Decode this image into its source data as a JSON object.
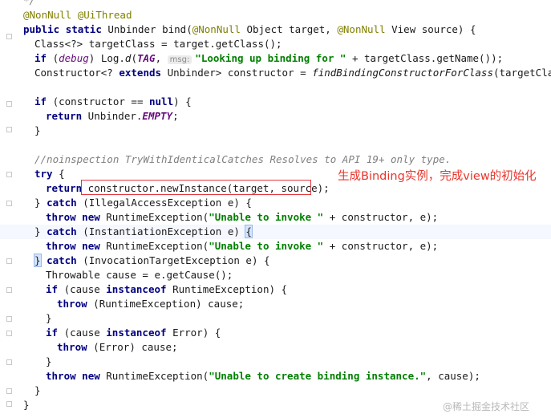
{
  "code": {
    "top_fragment": "*/",
    "annotation_line": {
      "a1": "@NonNull",
      "a2": "@UiThread"
    },
    "signature": {
      "k1": "public",
      "k2": "static",
      "t1": "Unbinder bind(",
      "a1": "@NonNull",
      "t2": " Object target, ",
      "a2": "@NonNull",
      "t3": " View source) {"
    },
    "line_target_class": "Class<?> targetClass = target.getClass();",
    "line_debug": {
      "k1": "if",
      "t1": " (",
      "debug": "debug",
      "t2": ") Log.",
      "d": "d",
      "t3": "(",
      "tag": "TAG",
      "t4": ",",
      "msg_hint": "msg:",
      "s1": "\"Looking up binding for \"",
      "t5": " + targetClass.getName());"
    },
    "line_constructor": {
      "t1": "Constructor<? ",
      "k1": "extends",
      "t2": " Unbinder> constructor = ",
      "m1": "findBindingConstructorForClass",
      "t3": "(targetClass);"
    },
    "line_if_null": {
      "k1": "if",
      "t1": " (constructor == ",
      "k2": "null",
      "t2": ") {"
    },
    "line_return_empty": {
      "k1": "return",
      "t1": " Unbinder.",
      "f1": "EMPTY",
      "t2": ";"
    },
    "close_brace": "}",
    "comment_noinspection": "//noinspection TryWithIdenticalCatches Resolves to API 19+ only type.",
    "line_try": {
      "k1": "try",
      "t1": " {"
    },
    "line_return_new_instance": {
      "k1": "return",
      "t1": " constructor.newInstance(target, source);"
    },
    "line_catch_illegal": {
      "t0": "} ",
      "k1": "catch",
      "t1": " (IllegalAccessException e) {"
    },
    "line_throw1": {
      "k1": "throw",
      "k2": "new",
      "t1": " RuntimeException(",
      "s1": "\"Unable to invoke \"",
      "t2": " + constructor, e);"
    },
    "line_catch_instantiation": {
      "t0": "} ",
      "k1": "catch",
      "t1": " (InstantiationException e) ",
      "b1": "{"
    },
    "line_throw2": {
      "k1": "throw",
      "k2": "new",
      "t1": " RuntimeException(",
      "s1": "\"Unable to invoke \"",
      "t2": " + constructor, e);"
    },
    "line_catch_ite": {
      "b0": "}",
      "k1": "catch",
      "t1": " (InvocationTargetException e) {"
    },
    "line_throwable": "Throwable cause = e.getCause();",
    "line_if_runtime": {
      "k1": "if",
      "t1": " (cause ",
      "k2": "instanceof",
      "t2": " RuntimeException) {"
    },
    "line_throw_runtime": {
      "k1": "throw",
      "t1": " (RuntimeException) cause;"
    },
    "line_if_error": {
      "k1": "if",
      "t1": " (cause ",
      "k2": "instanceof",
      "t2": " Error) {"
    },
    "line_throw_error": {
      "k1": "throw",
      "t1": " (Error) cause;"
    },
    "line_throw_final": {
      "k1": "throw",
      "k2": "new",
      "t1": " RuntimeException(",
      "s1": "\"Unable to create binding instance.\"",
      "t2": ", cause);"
    }
  },
  "annotation_text": "生成Binding实例，完成view的初始化",
  "watermark": "@稀土掘金技术社区",
  "colors": {
    "keyword": "#000080",
    "annotation": "#808000",
    "string": "#008000",
    "comment": "#808080",
    "field": "#660e7a",
    "highlight_box": "#e0383e",
    "annotation_text": "#e8352b"
  }
}
